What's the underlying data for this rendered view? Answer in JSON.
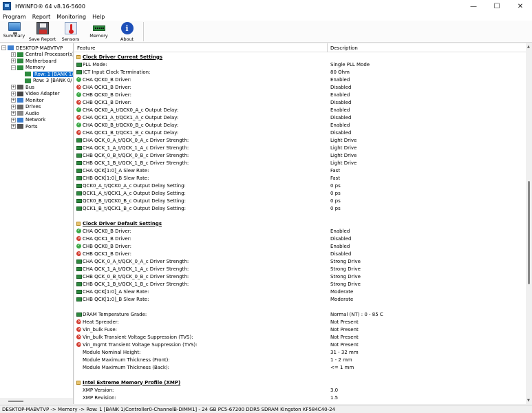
{
  "window": {
    "title": "HWiNFO® 64 v8.16-5600",
    "minimize_icon": "minimize-icon",
    "maximize_icon": "maximize-icon",
    "close_icon": "close-icon"
  },
  "menu": [
    "Program",
    "Report",
    "Monitoring",
    "Help"
  ],
  "toolbar": [
    {
      "label": "Summary",
      "icon": "monitor-icon"
    },
    {
      "label": "Save Report",
      "icon": "floppy-icon"
    },
    {
      "label": "Sensors",
      "icon": "thermometer-icon"
    },
    {
      "label": "Memory",
      "icon": "ram-icon"
    },
    {
      "label": "About",
      "icon": "info-icon"
    }
  ],
  "tree": [
    {
      "label": "DESKTOP-MABVTVP",
      "expander": "−"
    },
    {
      "label": "Central Processor(s)",
      "expander": "+"
    },
    {
      "label": "Motherboard",
      "expander": "+"
    },
    {
      "label": "Memory",
      "expander": "−"
    },
    {
      "label": "Row: 1 [BANK 1/",
      "expander": "",
      "selected": true
    },
    {
      "label": "Row: 3 [BANK 0/",
      "expander": ""
    },
    {
      "label": "Bus",
      "expander": "+"
    },
    {
      "label": "Video Adapter",
      "expander": "+"
    },
    {
      "label": "Monitor",
      "expander": "+"
    },
    {
      "label": "Drives",
      "expander": "+"
    },
    {
      "label": "Audio",
      "expander": "+"
    },
    {
      "label": "Network",
      "expander": "+"
    },
    {
      "label": "Ports",
      "expander": "+"
    }
  ],
  "columns": {
    "feature": "Feature",
    "description": "Description"
  },
  "rows": [
    {
      "type": "section",
      "feature": "Clock Driver Current Settings",
      "desc": ""
    },
    {
      "type": "pcb",
      "feature": "PLL Mode:",
      "desc": "Single PLL Mode"
    },
    {
      "type": "pcb",
      "feature": "ICT Input Clock Termination:",
      "desc": "80 Ohm"
    },
    {
      "type": "ok",
      "feature": "CHA QCK0_B Driver:",
      "desc": "Enabled"
    },
    {
      "type": "no",
      "feature": "CHA QCK1_B Driver:",
      "desc": "Disabled"
    },
    {
      "type": "ok",
      "feature": "CHB QCK0_B Driver:",
      "desc": "Enabled"
    },
    {
      "type": "no",
      "feature": "CHB QCK1_B Driver:",
      "desc": "Disabled"
    },
    {
      "type": "ok",
      "feature": "CHA QCK0_A_t/QCK0_A_c Output Delay:",
      "desc": "Enabled"
    },
    {
      "type": "no",
      "feature": "CHA QCK1_A_t/QCK1_A_c Output Delay:",
      "desc": "Disabled"
    },
    {
      "type": "ok",
      "feature": "CHA QCK0_B_t/QCK0_B_c Output Delay:",
      "desc": "Enabled"
    },
    {
      "type": "no",
      "feature": "CHA QCK1_B_t/QCK1_B_c Output Delay:",
      "desc": "Disabled"
    },
    {
      "type": "pcb",
      "feature": "CHA QCK_0_A_t/QCK_0_A_c Driver Strength:",
      "desc": "Light Drive"
    },
    {
      "type": "pcb",
      "feature": "CHA QCK_1_A_t/QCK_1_A_c Driver Strength:",
      "desc": "Light Drive"
    },
    {
      "type": "pcb",
      "feature": "CHB QCK_0_B_t/QCK_0_B_c Driver Strength:",
      "desc": "Light Drive"
    },
    {
      "type": "pcb",
      "feature": "CHB QCK_1_B_t/QCK_1_B_c Driver Strength:",
      "desc": "Light Drive"
    },
    {
      "type": "pcb",
      "feature": "CHA QCK[1:0]_A Slew Rate:",
      "desc": "Fast"
    },
    {
      "type": "pcb",
      "feature": "CHB QCK[1:0]_B Slew Rate:",
      "desc": "Fast"
    },
    {
      "type": "pcb",
      "feature": "QCK0_A_t/QCK0_A_c Output Delay Setting:",
      "desc": "0 ps"
    },
    {
      "type": "pcb",
      "feature": "QCK1_A_t/QCK1_A_c Output Delay Setting:",
      "desc": "0 ps"
    },
    {
      "type": "pcb",
      "feature": "QCK0_B_t/QCK0_B_c Output Delay Setting:",
      "desc": "0 ps"
    },
    {
      "type": "pcb",
      "feature": "QCK1_B_t/QCK1_B_c Output Delay Setting:",
      "desc": "0 ps"
    },
    {
      "type": "blank",
      "feature": "",
      "desc": ""
    },
    {
      "type": "section",
      "feature": "Clock Driver Default Settings",
      "desc": ""
    },
    {
      "type": "ok",
      "feature": "CHA QCK0_B Driver:",
      "desc": "Enabled"
    },
    {
      "type": "no",
      "feature": "CHA QCK1_B Driver:",
      "desc": "Disabled"
    },
    {
      "type": "ok",
      "feature": "CHB QCK0_B Driver:",
      "desc": "Enabled"
    },
    {
      "type": "no",
      "feature": "CHB QCK1_B Driver:",
      "desc": "Disabled"
    },
    {
      "type": "pcb",
      "feature": "CHA QCK_0_A_t/QCK_0_A_c Driver Strength:",
      "desc": "Strong Drive"
    },
    {
      "type": "pcb",
      "feature": "CHA QCK_1_A_t/QCK_1_A_c Driver Strength:",
      "desc": "Strong Drive"
    },
    {
      "type": "pcb",
      "feature": "CHB QCK_0_B_t/QCK_0_B_c Driver Strength:",
      "desc": "Strong Drive"
    },
    {
      "type": "pcb",
      "feature": "CHB QCK_1_B_t/QCK_1_B_c Driver Strength:",
      "desc": "Strong Drive"
    },
    {
      "type": "pcb",
      "feature": "CHA QCK[1:0]_A Slew Rate:",
      "desc": "Moderate"
    },
    {
      "type": "pcb",
      "feature": "CHB QCK[1:0]_B Slew Rate:",
      "desc": "Moderate"
    },
    {
      "type": "blank",
      "feature": "",
      "desc": ""
    },
    {
      "type": "pcb",
      "feature": "DRAM Temperature Grade:",
      "desc": "Normal (NT) : 0 - 85 C"
    },
    {
      "type": "no",
      "feature": "Heat Spreader:",
      "desc": "Not Present"
    },
    {
      "type": "no",
      "feature": "Vin_bulk Fuse:",
      "desc": "Not Present"
    },
    {
      "type": "no",
      "feature": "Vin_bulk Transient Voltage Suppression (TVS):",
      "desc": "Not Present"
    },
    {
      "type": "no",
      "feature": "Vin_mgmt Transient Voltage Suppression (TVS):",
      "desc": "Not Present"
    },
    {
      "type": "none",
      "feature": "Module Nominal Height:",
      "desc": "31 - 32 mm"
    },
    {
      "type": "none",
      "feature": "Module Maximum Thickness (Front):",
      "desc": "1 - 2 mm"
    },
    {
      "type": "none",
      "feature": "Module Maximum Thickness (Back):",
      "desc": "<= 1 mm"
    },
    {
      "type": "blank",
      "feature": "",
      "desc": ""
    },
    {
      "type": "section",
      "feature": "Intel Extreme Memory Profile (XMP)",
      "desc": ""
    },
    {
      "type": "none",
      "feature": "XMP Version:",
      "desc": "3.0"
    },
    {
      "type": "none",
      "feature": "XMP Revision:",
      "desc": "1.5"
    }
  ],
  "status": "DESKTOP-MABVTVP -> Memory -> Row: 1 [BANK 1/Controller0-ChannelB-DIMM1] - 24 GB PC5-67200 DDR5 SDRAM Kingston KF584C40-24"
}
